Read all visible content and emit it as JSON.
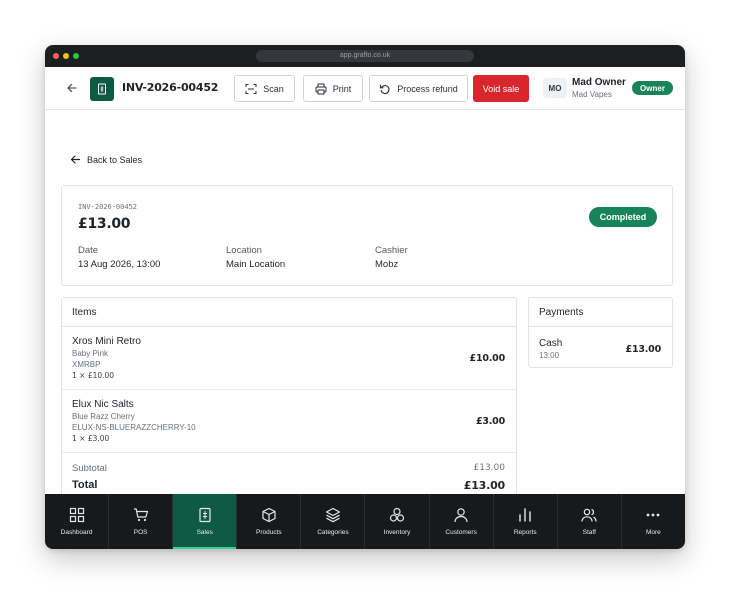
{
  "browser": {
    "url": "app.grafto.co.uk"
  },
  "header": {
    "invoice_number": "INV-2026-00452",
    "buttons": {
      "scan": "Scan",
      "print": "Print",
      "refund": "Process refund",
      "void": "Void sale"
    },
    "user": {
      "initials": "MO",
      "name": "Mad Owner",
      "org": "Mad Vapes",
      "role": "Owner"
    }
  },
  "back_link": "Back to Sales",
  "summary": {
    "id": "INV-2026-00452",
    "amount": "£13.00",
    "status": "Completed",
    "meta": [
      {
        "label": "Date",
        "value": "13 Aug 2026, 13:00"
      },
      {
        "label": "Location",
        "value": "Main Location"
      },
      {
        "label": "Cashier",
        "value": "Mobz"
      }
    ]
  },
  "items": {
    "title": "Items",
    "rows": [
      {
        "name": "Xros Mini Retro",
        "variant": "Baby Pink",
        "sku": "XMRBP",
        "qty": "1 × £10.00",
        "price": "£10.00"
      },
      {
        "name": "Elux Nic Salts",
        "variant": "Blue Razz Cherry",
        "sku": "ELUX-NS-BLUERAZZCHERRY-10",
        "qty": "1 × £3.00",
        "price": "£3.00"
      }
    ],
    "subtotal_label": "Subtotal",
    "subtotal": "£13.00",
    "total_label": "Total",
    "total": "£13.00"
  },
  "payments": {
    "title": "Payments",
    "rows": [
      {
        "method": "Cash",
        "time": "13:00",
        "amount": "£13.00"
      }
    ]
  },
  "nav": [
    {
      "label": "Dashboard",
      "icon": "grid-icon"
    },
    {
      "label": "POS",
      "icon": "cart-icon"
    },
    {
      "label": "Sales",
      "icon": "receipt-icon",
      "active": true
    },
    {
      "label": "Products",
      "icon": "box-icon"
    },
    {
      "label": "Categories",
      "icon": "layers-icon"
    },
    {
      "label": "Inventory",
      "icon": "circles-icon"
    },
    {
      "label": "Customers",
      "icon": "user-icon"
    },
    {
      "label": "Reports",
      "icon": "bar-chart-icon"
    },
    {
      "label": "Staff",
      "icon": "users-icon"
    },
    {
      "label": "More",
      "icon": "dots-icon"
    }
  ],
  "colors": {
    "brand": "#0f5a43",
    "status_green": "#17835a",
    "danger": "#d9252c",
    "nav_bg": "#17191b"
  }
}
